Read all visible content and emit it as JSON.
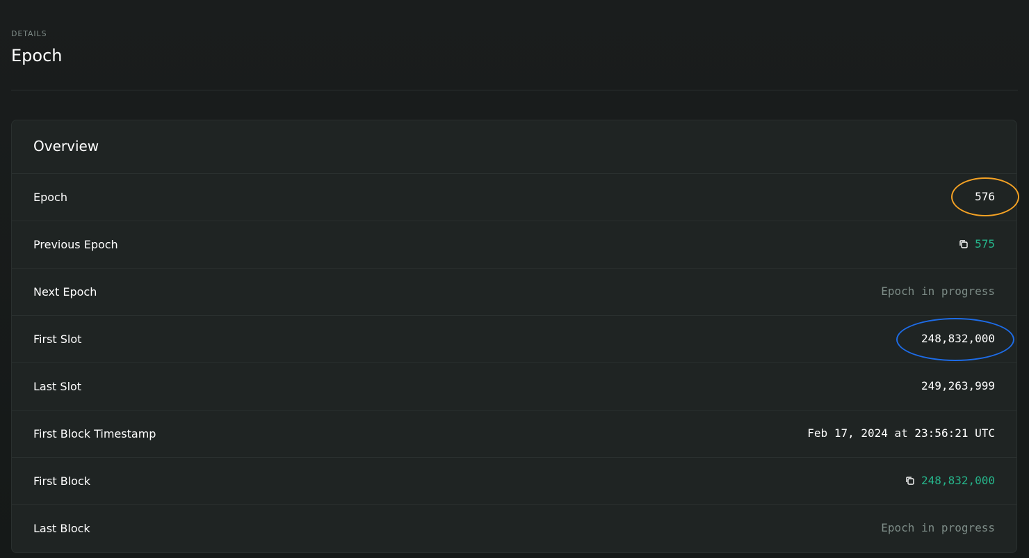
{
  "header": {
    "pretitle": "DETAILS",
    "title": "Epoch"
  },
  "overview": {
    "title": "Overview",
    "rows": [
      {
        "label": "Epoch",
        "value": "576"
      },
      {
        "label": "Previous Epoch",
        "value": "575"
      },
      {
        "label": "Next Epoch",
        "value": "Epoch in progress"
      },
      {
        "label": "First Slot",
        "value": "248,832,000"
      },
      {
        "label": "Last Slot",
        "value": "249,263,999"
      },
      {
        "label": "First Block Timestamp",
        "value": "Feb 17, 2024 at 23:56:21 UTC"
      },
      {
        "label": "First Block",
        "value": "248,832,000"
      },
      {
        "label": "Last Block",
        "value": "Epoch in progress"
      }
    ]
  },
  "icons": {
    "copy": "copy-icon"
  },
  "colors": {
    "link": "#26b58b",
    "muted": "#7c8b86",
    "highlight_orange": "#f5a224",
    "highlight_blue": "#1d6ce8"
  }
}
